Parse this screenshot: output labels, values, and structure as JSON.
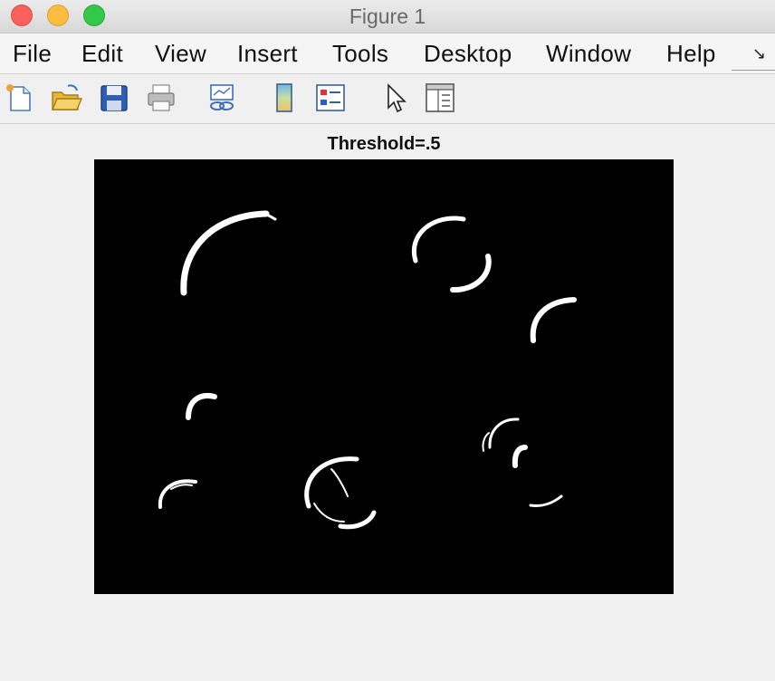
{
  "window": {
    "title": "Figure 1"
  },
  "menu": {
    "items": [
      "File",
      "Edit",
      "View",
      "Insert",
      "Tools",
      "Desktop",
      "Window",
      "Help"
    ],
    "overflow_icon": "dock-arrow-icon"
  },
  "toolbar": {
    "buttons": [
      {
        "icon": "new-figure-icon"
      },
      {
        "icon": "open-file-icon"
      },
      {
        "icon": "save-icon"
      },
      {
        "icon": "print-icon"
      },
      {
        "icon": "link-plot-icon"
      },
      {
        "icon": "insert-colorbar-icon"
      },
      {
        "icon": "insert-legend-icon"
      },
      {
        "icon": "edit-plot-pointer-icon"
      },
      {
        "icon": "property-inspector-icon"
      }
    ]
  },
  "figure": {
    "title": "Threshold=.5",
    "background": "#000000",
    "foreground": "#ffffff"
  }
}
